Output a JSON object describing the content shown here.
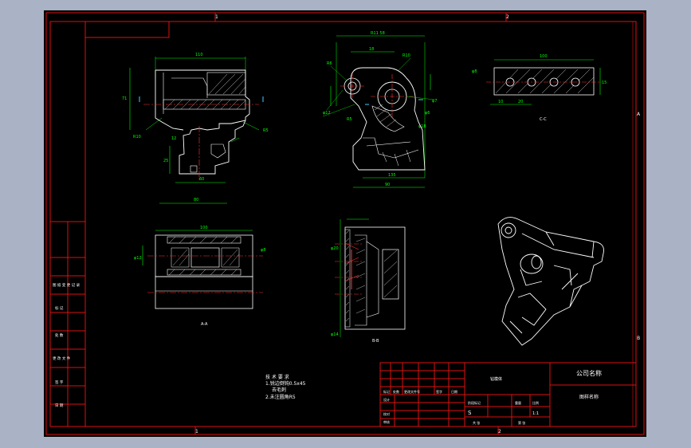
{
  "zones": {
    "top": [
      "1",
      "2"
    ],
    "bottom": [
      "1",
      "2"
    ],
    "right": [
      "A",
      "B"
    ]
  },
  "left_table": [
    "图 纸 变 更 记 录",
    "标 记",
    "处 数",
    "更 改 文 件",
    "签 字",
    "日 期"
  ],
  "dims": {
    "v1_width": "110",
    "v1_height": "71",
    "v1_radius": "R10",
    "v1_r5": "R5",
    "v1_depth": "25",
    "v1_bottom": "60",
    "v1_bottom2": "80",
    "v1_small": "12",
    "v2_top": "R11 58",
    "v2_top2": "R6",
    "v2_18": "18",
    "v2_r10": "R10",
    "v2_r6": "R6",
    "v2_phi7": "φ7",
    "v2_phi12": "φ12",
    "v2_phi6": "φ6",
    "v2_r5": "R5",
    "v2_phi18": "φ18",
    "v2_width1": "135",
    "v2_width2": "90",
    "v3_width": "100",
    "v3_phi": "φ8",
    "v3_h": "15",
    "v3_bottom1": "10",
    "v3_bottom2": "20",
    "v3_label": "C-C",
    "v4_width": "100",
    "v4_phi": "φ12",
    "v4_side": "φ8",
    "v4_label": "A-A",
    "v5_left": "φ20",
    "v5_left2": "φ14",
    "v5_label": "B-B"
  },
  "notes": {
    "title": "技 术 要 求",
    "line1": "1.锐边倒钝0.5x45",
    "line2": "去毛刺",
    "line3": "2.未注圆角R5"
  },
  "title_block": {
    "drawing_name": "钻模体",
    "company": "公司名称",
    "drawing_no": "图样名称",
    "sign_row": [
      "标记",
      "处数",
      "更改文件号",
      "签字",
      "日期"
    ],
    "roles": [
      "设计",
      "校对",
      "审核"
    ],
    "cols": [
      "阶段标记",
      "重量",
      "比例"
    ],
    "scale": "1:1",
    "sheet": [
      "共 张",
      "第 张"
    ],
    "material": "S"
  }
}
